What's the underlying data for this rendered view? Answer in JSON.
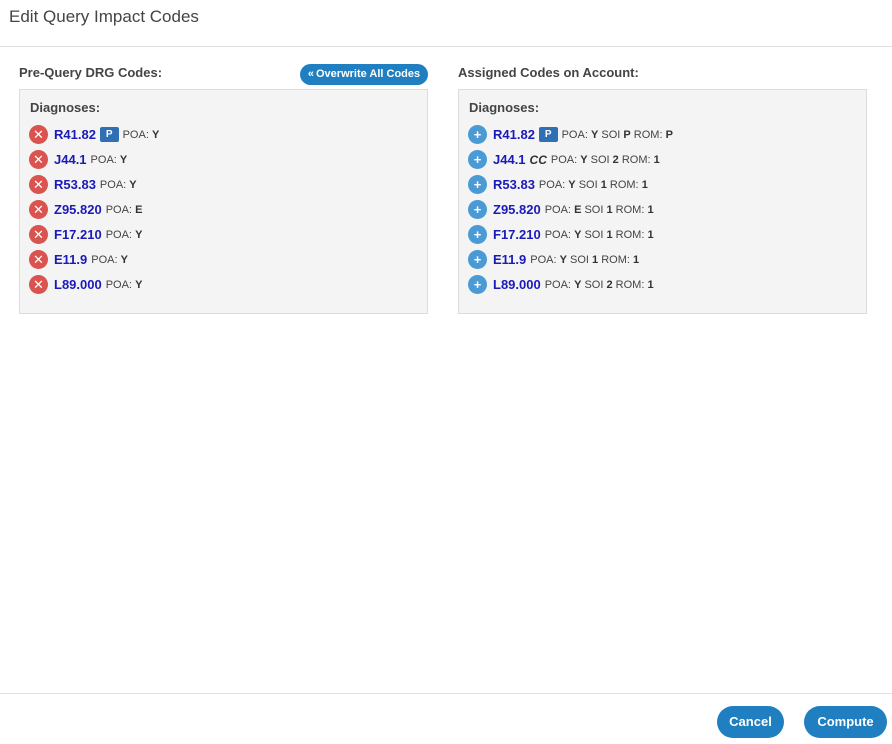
{
  "dialog": {
    "title": "Edit Query Impact Codes"
  },
  "left": {
    "title": "Pre-Query DRG Codes:",
    "overwrite_label": "Overwrite All Codes",
    "diagnoses_label": "Diagnoses:",
    "rows": [
      {
        "code": "R41.82",
        "badge": "P",
        "meta_key": "POA:",
        "poa": "Y"
      },
      {
        "code": "J44.1",
        "meta_key": "POA:",
        "poa": "Y"
      },
      {
        "code": "R53.83",
        "meta_key": "POA:",
        "poa": "Y"
      },
      {
        "code": "Z95.820",
        "meta_key": "POA:",
        "poa": "E"
      },
      {
        "code": "F17.210",
        "meta_key": "POA:",
        "poa": "Y"
      },
      {
        "code": "E11.9",
        "meta_key": "POA:",
        "poa": "Y"
      },
      {
        "code": "L89.000",
        "meta_key": "POA:",
        "poa": "Y"
      }
    ]
  },
  "right": {
    "title": "Assigned Codes on Account:",
    "diagnoses_label": "Diagnoses:",
    "rows": [
      {
        "code": "R41.82",
        "badge": "P",
        "poa_key": "POA:",
        "poa": "Y",
        "soi_key": "SOI",
        "soi": "P",
        "rom_key": "ROM:",
        "rom": "P"
      },
      {
        "code": "J44.1",
        "cc": "CC",
        "poa_key": "POA:",
        "poa": "Y",
        "soi_key": "SOI",
        "soi": "2",
        "rom_key": "ROM:",
        "rom": "1"
      },
      {
        "code": "R53.83",
        "poa_key": "POA:",
        "poa": "Y",
        "soi_key": "SOI",
        "soi": "1",
        "rom_key": "ROM:",
        "rom": "1"
      },
      {
        "code": "Z95.820",
        "poa_key": "POA:",
        "poa": "E",
        "soi_key": "SOI",
        "soi": "1",
        "rom_key": "ROM:",
        "rom": "1"
      },
      {
        "code": "F17.210",
        "poa_key": "POA:",
        "poa": "Y",
        "soi_key": "SOI",
        "soi": "1",
        "rom_key": "ROM:",
        "rom": "1"
      },
      {
        "code": "E11.9",
        "poa_key": "POA:",
        "poa": "Y",
        "soi_key": "SOI",
        "soi": "1",
        "rom_key": "ROM:",
        "rom": "1"
      },
      {
        "code": "L89.000",
        "poa_key": "POA:",
        "poa": "Y",
        "soi_key": "SOI",
        "soi": "2",
        "rom_key": "ROM:",
        "rom": "1"
      }
    ]
  },
  "footer": {
    "cancel_label": "Cancel",
    "compute_label": "Compute"
  },
  "colors": {
    "primary": "#1f7fc1",
    "remove": "#d9534f",
    "add": "#4a9ad6",
    "code_link": "#1a1ab8"
  },
  "icons": {
    "remove": "remove-circle-icon",
    "add": "add-circle-icon",
    "overwrite": "double-chevron-left-icon"
  }
}
